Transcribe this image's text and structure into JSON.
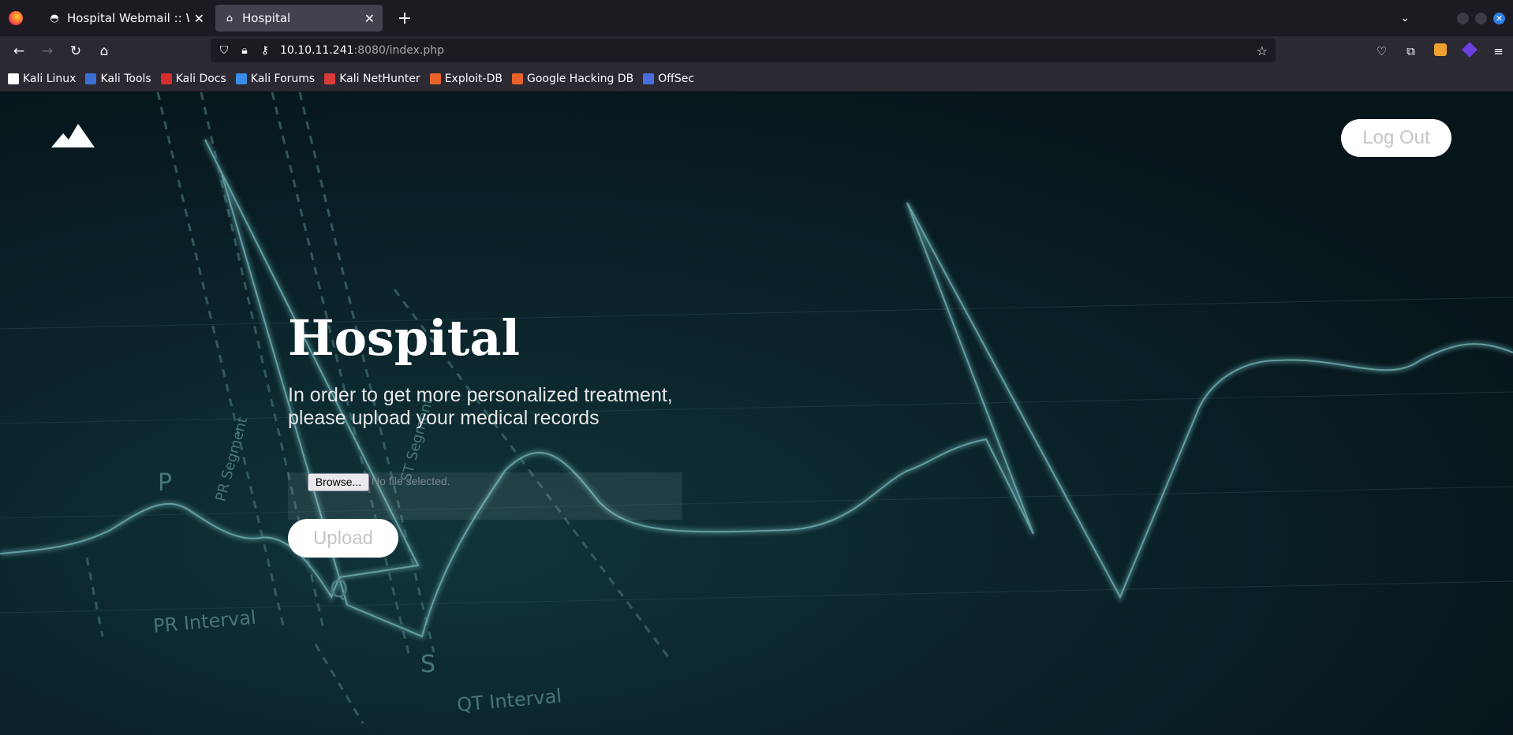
{
  "browser": {
    "tabs": [
      {
        "title": "Hospital Webmail :: Welco",
        "active": false
      },
      {
        "title": "Hospital",
        "active": true
      }
    ],
    "new_tab_label": "+",
    "url_host": "10.10.11.241",
    "url_rest": ":8080/index.php",
    "bookmarks": [
      {
        "label": "Kali Linux",
        "icon": "kali-icon",
        "color": "#ffffff"
      },
      {
        "label": "Kali Tools",
        "icon": "kali-tools-icon",
        "color": "#3b6fd6"
      },
      {
        "label": "Kali Docs",
        "icon": "kali-docs-icon",
        "color": "#d62d2d"
      },
      {
        "label": "Kali Forums",
        "icon": "kali-forums-icon",
        "color": "#3a8ee6"
      },
      {
        "label": "Kali NetHunter",
        "icon": "nethunter-icon",
        "color": "#d93a3a"
      },
      {
        "label": "Exploit-DB",
        "icon": "exploit-db-icon",
        "color": "#e8622a"
      },
      {
        "label": "Google Hacking DB",
        "icon": "ghdb-icon",
        "color": "#e8622a"
      },
      {
        "label": "OffSec",
        "icon": "offsec-icon",
        "color": "#4a6ee0"
      }
    ]
  },
  "page": {
    "logout_label": "Log Out",
    "title": "Hospital",
    "subtitle_line1": "In order to get more personalized treatment,",
    "subtitle_line2": "please upload your medical records",
    "browse_label": "Browse...",
    "no_file_label": "No file selected.",
    "upload_label": "Upload",
    "ecg_labels": {
      "p": "P",
      "q": "Q",
      "s": "S",
      "pr_segment": "PR Segment",
      "st_segment": "ST Segment",
      "pr_interval": "PR Interval",
      "qt_interval": "QT Interval"
    }
  }
}
